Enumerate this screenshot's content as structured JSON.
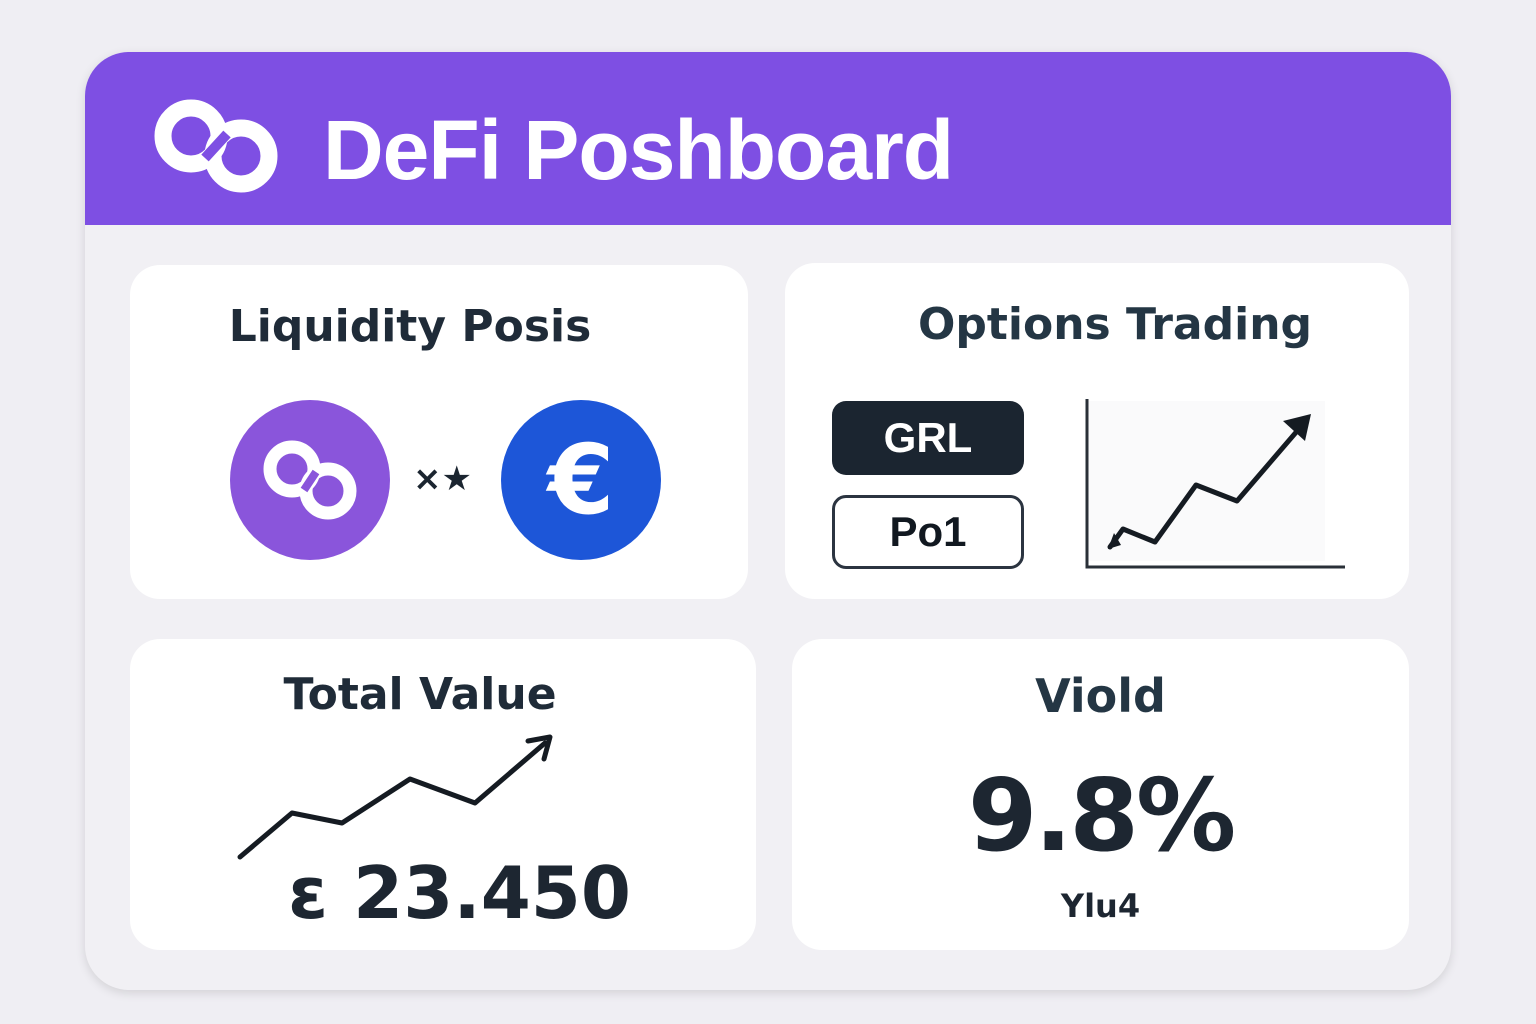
{
  "header": {
    "title": "DeFi Poshboard",
    "logo_icon": "infinity-logo-icon"
  },
  "liquidity": {
    "title": "Liquidity Posis",
    "pair_separator": "×★",
    "coin_left": {
      "icon": "infinity-coin-icon",
      "color": "#8a55db"
    },
    "coin_right": {
      "icon": "euro-coin-icon",
      "glyph": "€",
      "color": "#1d56d8"
    }
  },
  "options": {
    "title": "Options Trading",
    "buttons": [
      "GRL",
      "Po1"
    ],
    "chart_icon": "trend-up-chart-icon"
  },
  "total_value": {
    "title": "Total Value",
    "amount": "ε 23.450",
    "trend_icon": "trend-up-arrow-icon"
  },
  "yield": {
    "title": "Viold",
    "percent": "9.8%",
    "caption": "Ylu4"
  },
  "colors": {
    "brand": "#7e4fe3",
    "text_dark": "#1f2b38",
    "coin_purple": "#8a55db",
    "coin_blue": "#1d56d8"
  }
}
